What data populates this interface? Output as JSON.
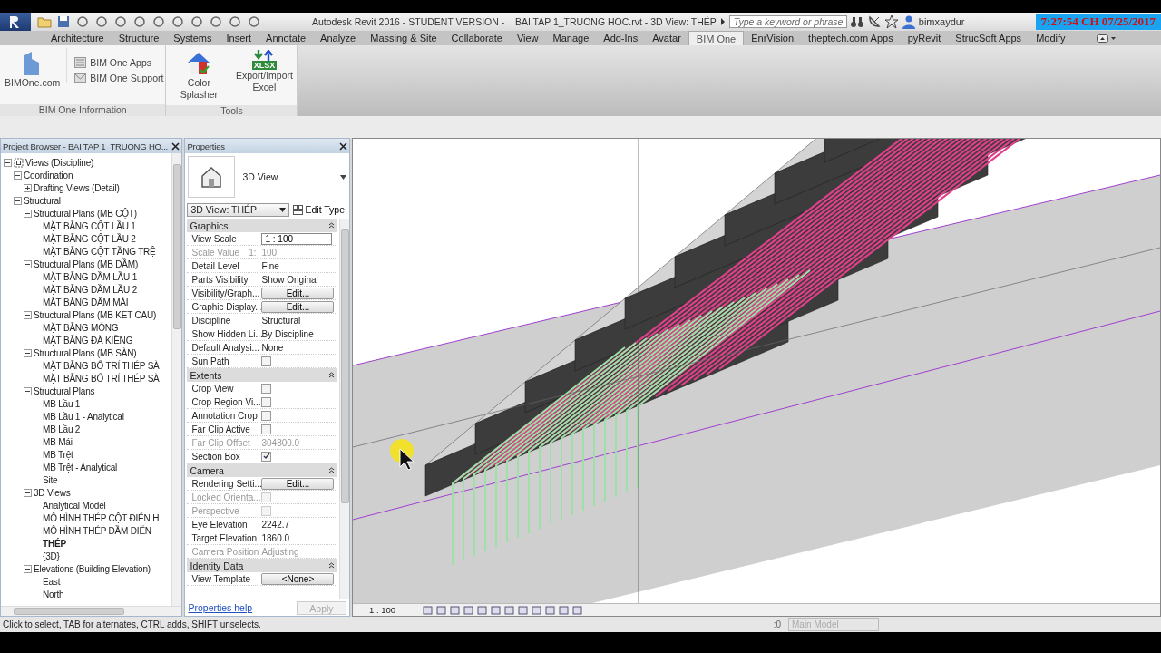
{
  "title_bar": {
    "title": "Autodesk Revit 2016 - STUDENT VERSION -    BAI TAP 1_TRUONG HOC.rvt - 3D View: THÉP",
    "search": {
      "placeholder": "Type a keyword or phrase"
    },
    "user": "bimxaydur",
    "clock": "7:27:54 CH 07/25/2017"
  },
  "ribbon_tabs": [
    {
      "label": "Architecture",
      "selected": false
    },
    {
      "label": "Structure",
      "selected": false
    },
    {
      "label": "Systems",
      "selected": false
    },
    {
      "label": "Insert",
      "selected": false
    },
    {
      "label": "Annotate",
      "selected": false
    },
    {
      "label": "Analyze",
      "selected": false
    },
    {
      "label": "Massing & Site",
      "selected": false
    },
    {
      "label": "Collaborate",
      "selected": false
    },
    {
      "label": "View",
      "selected": false
    },
    {
      "label": "Manage",
      "selected": false
    },
    {
      "label": "Add-Ins",
      "selected": false
    },
    {
      "label": "Avatar",
      "selected": false
    },
    {
      "label": "BIM One",
      "selected": true
    },
    {
      "label": "EnrVision",
      "selected": false
    },
    {
      "label": "theptech.com Apps",
      "selected": false
    },
    {
      "label": "pyRevit",
      "selected": false
    },
    {
      "label": "StrucSoft Apps",
      "selected": false
    },
    {
      "label": "Modify",
      "selected": false
    }
  ],
  "ribbon_panels": [
    {
      "title": "BIM One Information",
      "buttons": [
        {
          "label": "BIMOne.com",
          "kind": "large"
        },
        {
          "label": "BIM One Apps",
          "kind": "small"
        },
        {
          "label": "BIM One Support",
          "kind": "small"
        }
      ]
    },
    {
      "title": "Tools",
      "buttons": [
        {
          "label": "Color Splasher",
          "kind": "large"
        },
        {
          "label": "Export/Import Excel",
          "kind": "large",
          "badge": "XLSX"
        }
      ]
    }
  ],
  "project_browser": {
    "title": "Project Browser - BAI TAP 1_TRUONG HO...",
    "tree": [
      {
        "label": "Views (Discipline)",
        "expanded": true,
        "children": [
          {
            "label": "Coordination",
            "expanded": true,
            "children": [
              {
                "label": "Drafting Views (Detail)",
                "expanded": false
              }
            ]
          },
          {
            "label": "Structural",
            "expanded": true,
            "children": [
              {
                "label": "Structural Plans (MB CỘT)",
                "expanded": true,
                "children": [
                  {
                    "label": "MẶT BẰNG CỘT LẦU 1",
                    "active": false
                  },
                  {
                    "label": "MẶT BẰNG CỘT LẦU 2",
                    "active": false
                  },
                  {
                    "label": "MẶT BẰNG CỘT TẦNG TRỆ",
                    "active": false
                  }
                ]
              },
              {
                "label": "Structural Plans (MB DẦM)",
                "expanded": true,
                "children": [
                  {
                    "label": "MẶT BẰNG DẦM LẦU 1",
                    "active": false
                  },
                  {
                    "label": "MẶT BẰNG DẦM LẦU 2",
                    "active": false
                  },
                  {
                    "label": "MẶT BẰNG DẦM MÁI",
                    "active": false
                  }
                ]
              },
              {
                "label": "Structural Plans (MB KET CAU)",
                "expanded": true,
                "children": [
                  {
                    "label": "MẶT BẰNG MÓNG",
                    "active": false
                  },
                  {
                    "label": "MẶT BẰNG ĐÀ KIỀNG",
                    "active": false
                  }
                ]
              },
              {
                "label": "Structural Plans (MB SÀN)",
                "expanded": true,
                "children": [
                  {
                    "label": "MẶT BẰNG BỐ TRÍ THÉP SÀ",
                    "active": false
                  },
                  {
                    "label": "MẶT BẰNG BỐ TRÍ THÉP SÀ",
                    "active": false
                  }
                ]
              },
              {
                "label": "Structural Plans",
                "expanded": true,
                "children": [
                  {
                    "label": "MB Lầu 1",
                    "active": false
                  },
                  {
                    "label": "MB Lầu 1 - Analytical",
                    "active": false
                  },
                  {
                    "label": "MB Lầu 2",
                    "active": false
                  },
                  {
                    "label": "MB Mái",
                    "active": false
                  },
                  {
                    "label": "MB Trệt",
                    "active": false
                  },
                  {
                    "label": "MB Trệt - Analytical",
                    "active": false
                  },
                  {
                    "label": "Site",
                    "active": false
                  }
                ]
              },
              {
                "label": "3D Views",
                "expanded": true,
                "children": [
                  {
                    "label": "Analytical Model",
                    "active": false
                  },
                  {
                    "label": "MÔ HÌNH THÉP CỘT ĐIỂN H",
                    "active": false
                  },
                  {
                    "label": "MÔ HÌNH THÉP DẦM ĐIỂN",
                    "active": false
                  },
                  {
                    "label": "THÉP",
                    "active": true
                  },
                  {
                    "label": "{3D}",
                    "active": false
                  }
                ]
              },
              {
                "label": "Elevations (Building Elevation)",
                "expanded": true,
                "children": [
                  {
                    "label": "East",
                    "active": false
                  },
                  {
                    "label": "North",
                    "active": false
                  }
                ]
              }
            ]
          }
        ]
      }
    ]
  },
  "properties": {
    "title": "Properties",
    "type_name": "3D View",
    "selector": "3D View: THÉP",
    "edit_type": "Edit Type",
    "sections": [
      {
        "title": "Graphics",
        "expanded": true,
        "rows": [
          {
            "name": "View Scale",
            "kind": "input",
            "value": "1 : 100",
            "disabled": false
          },
          {
            "name": "Scale Value",
            "prefix": "1:",
            "kind": "text",
            "value": "100",
            "disabled": true
          },
          {
            "name": "Detail Level",
            "kind": "text",
            "value": "Fine",
            "disabled": false
          },
          {
            "name": "Parts Visibility",
            "kind": "text",
            "value": "Show Original",
            "disabled": false
          },
          {
            "name": "Visibility/Graph...",
            "kind": "button",
            "value": "Edit...",
            "disabled": false
          },
          {
            "name": "Graphic Display...",
            "kind": "button",
            "value": "Edit...",
            "disabled": false
          },
          {
            "name": "Discipline",
            "kind": "text",
            "value": "Structural",
            "disabled": false
          },
          {
            "name": "Show Hidden Li...",
            "kind": "text",
            "value": "By Discipline",
            "disabled": false
          },
          {
            "name": "Default Analysi...",
            "kind": "text",
            "value": "None",
            "disabled": false
          },
          {
            "name": "Sun Path",
            "kind": "checkbox",
            "checked": false,
            "disabled": false
          }
        ]
      },
      {
        "title": "Extents",
        "expanded": true,
        "rows": [
          {
            "name": "Crop View",
            "kind": "checkbox",
            "checked": false,
            "disabled": false
          },
          {
            "name": "Crop Region Vi...",
            "kind": "checkbox",
            "checked": false,
            "disabled": false
          },
          {
            "name": "Annotation Crop",
            "kind": "checkbox",
            "checked": false,
            "disabled": false
          },
          {
            "name": "Far Clip Active",
            "kind": "checkbox",
            "checked": false,
            "disabled": false
          },
          {
            "name": "Far Clip Offset",
            "kind": "text",
            "value": "304800.0",
            "disabled": true
          },
          {
            "name": "Section Box",
            "kind": "checkbox",
            "checked": true,
            "disabled": false
          }
        ]
      },
      {
        "title": "Camera",
        "expanded": true,
        "rows": [
          {
            "name": "Rendering Setti...",
            "kind": "button",
            "value": "Edit...",
            "disabled": false
          },
          {
            "name": "Locked Orienta...",
            "kind": "checkbox",
            "checked": false,
            "disabled": true
          },
          {
            "name": "Perspective",
            "kind": "checkbox",
            "checked": false,
            "disabled": true
          },
          {
            "name": "Eye Elevation",
            "kind": "text",
            "value": "2242.7",
            "disabled": false
          },
          {
            "name": "Target Elevation",
            "kind": "text",
            "value": "1860.0",
            "disabled": false
          },
          {
            "name": "Camera Position",
            "kind": "text",
            "value": "Adjusting",
            "disabled": true
          }
        ]
      },
      {
        "title": "Identity Data",
        "expanded": true,
        "rows": [
          {
            "name": "View Template",
            "kind": "button",
            "value": "<None>",
            "disabled": false
          }
        ]
      }
    ],
    "help_link": "Properties help",
    "apply": {
      "label": "Apply",
      "disabled": true
    }
  },
  "view_bar": {
    "scale": "1 : 100"
  },
  "status_bar": {
    "message": "Click to select, TAB for alternates, CTRL adds, SHIFT unselects.",
    "count": ":0",
    "model": "Main Model"
  }
}
